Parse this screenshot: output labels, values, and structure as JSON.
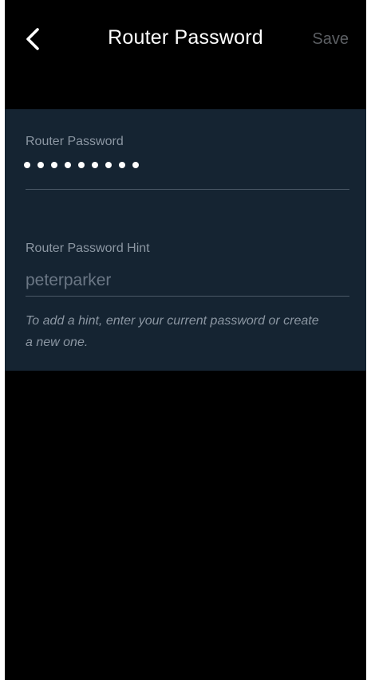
{
  "header": {
    "title": "Router Password",
    "save_label": "Save"
  },
  "password": {
    "label": "Router Password",
    "masked_length": 9
  },
  "hint": {
    "label": "Router Password Hint",
    "value": "peterparker",
    "help_text": "To add a hint, enter your current password or create a new one."
  },
  "colors": {
    "background": "#000000",
    "panel": "#152432",
    "title": "#ffffff",
    "save_disabled": "#5c5f63",
    "label": "#8b96a2"
  },
  "icons": {
    "back": "chevron-left-icon"
  }
}
